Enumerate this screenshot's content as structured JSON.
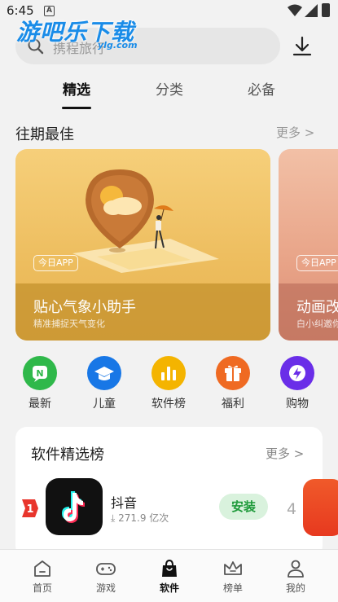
{
  "status_bar": {
    "time": "6:45",
    "notification_badge": "A"
  },
  "watermark": {
    "main": "游吧乐下载",
    "sub": "ylg.com"
  },
  "search": {
    "placeholder": "携程旅行"
  },
  "tabs": [
    {
      "label": "精选",
      "active": true
    },
    {
      "label": "分类",
      "active": false
    },
    {
      "label": "必备",
      "active": false
    }
  ],
  "featured": {
    "title": "往期最佳",
    "more": "更多 >"
  },
  "banners": [
    {
      "badge": "今日APP",
      "title": "贴心气象小助手",
      "subtitle": "精准捕捉天气变化",
      "color": "#edbd5e"
    },
    {
      "badge": "今日APP",
      "title": "动画改",
      "subtitle": "白小纠邀你",
      "color": "#e8a387"
    }
  ],
  "categories": [
    {
      "label": "最新",
      "icon": "new-icon",
      "color": "#2fb84a"
    },
    {
      "label": "儿童",
      "icon": "graduation-cap-icon",
      "color": "#1877e6"
    },
    {
      "label": "软件榜",
      "icon": "bar-chart-icon",
      "color": "#f4b400"
    },
    {
      "label": "福利",
      "icon": "gift-icon",
      "color": "#ef6a22"
    },
    {
      "label": "购物",
      "icon": "lightning-icon",
      "color": "#6a2ee8"
    }
  ],
  "ranking": {
    "title": "软件精选榜",
    "more": "更多 >",
    "items": [
      {
        "rank": "1",
        "name": "抖音",
        "downloads": "271.9 亿次",
        "action": "安装"
      },
      {
        "rank": "4"
      }
    ]
  },
  "bottom_nav": [
    {
      "label": "首页",
      "icon": "home-icon",
      "active": false
    },
    {
      "label": "游戏",
      "icon": "gamepad-icon",
      "active": false
    },
    {
      "label": "软件",
      "icon": "shopping-bag-icon",
      "active": true
    },
    {
      "label": "榜单",
      "icon": "crown-icon",
      "active": false
    },
    {
      "label": "我的",
      "icon": "user-icon",
      "active": false
    }
  ]
}
